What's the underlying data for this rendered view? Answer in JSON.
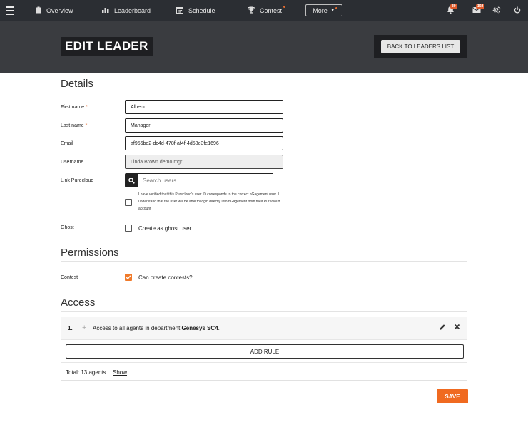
{
  "nav": {
    "items": [
      {
        "label": "Overview",
        "icon": "clipboard-icon"
      },
      {
        "label": "Leaderboard",
        "icon": "bar-chart-icon"
      },
      {
        "label": "Schedule",
        "icon": "calendar-icon"
      },
      {
        "label": "Contest",
        "icon": "trophy-icon"
      }
    ],
    "more_label": "More",
    "bell_badge": "30",
    "mail_badge": "102"
  },
  "header": {
    "title": "EDIT LEADER",
    "back_label": "BACK TO LEADERS LIST"
  },
  "details": {
    "title": "Details",
    "first_name_label": "First name",
    "first_name_value": "Alberto",
    "last_name_label": "Last name",
    "last_name_value": "Manager",
    "email_label": "Email",
    "email_value": "af956be2-dc4d-478f-af4f-4d58e3fe1696",
    "username_label": "Username",
    "username_value": "Linda.Brown.demo.mgr",
    "link_label": "Link Purecloud",
    "search_placeholder": "Search users...",
    "verify_text": "I have verified that this Purecloud's user ID corresponds to the correct nGagement user. I understand that the user will be able to login directly into nGagement from their Purecloud account",
    "ghost_label": "Ghost",
    "ghost_checkbox_label": "Create as ghost user",
    "required_mark": "*"
  },
  "permissions": {
    "title": "Permissions",
    "contest_label": "Contest",
    "contest_checkbox_label": "Can create contests?",
    "contest_checked": true
  },
  "access": {
    "title": "Access",
    "rule_number": "1.",
    "rule_text_prefix": "Access to all agents in department ",
    "rule_text_dept": "Genesys SC4",
    "rule_text_suffix": ".",
    "add_rule_label": "ADD RULE",
    "total_text": "Total: 13 agents",
    "show_label": "Show"
  },
  "footer": {
    "save_label": "SAVE"
  },
  "colors": {
    "accent": "#f06a20",
    "nav_bg": "#2b2e33",
    "banner_bg": "#3a3c40"
  }
}
